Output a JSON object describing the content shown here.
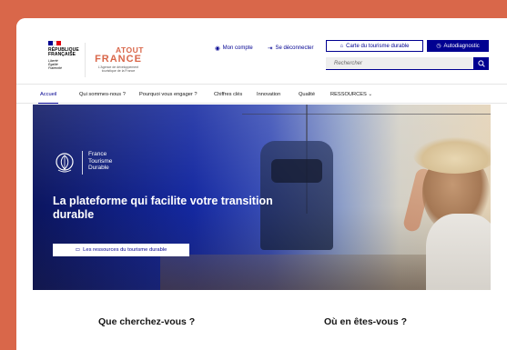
{
  "header": {
    "republique": {
      "line1": "RÉPUBLIQUE",
      "line2": "FRANÇAISE",
      "motto": [
        "Liberté",
        "Égalité",
        "Fraternité"
      ]
    },
    "atout": {
      "top": "ATOUT",
      "main": "FRANCE",
      "sub": "L'Agence de développement touristique de la France"
    },
    "links": {
      "account": "Mon compte",
      "logout": "Se déconnecter"
    },
    "buttons": {
      "map": "Carte du tourisme durable",
      "diagnostic": "Autodiagnostic"
    },
    "search": {
      "placeholder": "Rechercher"
    }
  },
  "nav": {
    "items": [
      {
        "label": "Accueil"
      },
      {
        "label": "Qui sommes-nous ?"
      },
      {
        "label": "Pourquoi vous engager ?"
      },
      {
        "label": "Chiffres clés"
      },
      {
        "label": "Innovation"
      },
      {
        "label": "Qualité"
      },
      {
        "label": "RESSOURCES ⌄"
      }
    ]
  },
  "hero": {
    "brand": [
      "France",
      "Tourisme",
      "Durable"
    ],
    "title": "La plateforme qui facilite votre transition durable",
    "button": "Les ressources du tourisme durable"
  },
  "sections": {
    "left_title": "Que cherchez-vous ?",
    "right_title": "Où en êtes-vous ?"
  },
  "colors": {
    "background": "#d9674a",
    "primary": "#000091",
    "accent": "#d9674a",
    "flag_blue": "#000091",
    "flag_white": "#ffffff",
    "flag_red": "#e1000f"
  }
}
